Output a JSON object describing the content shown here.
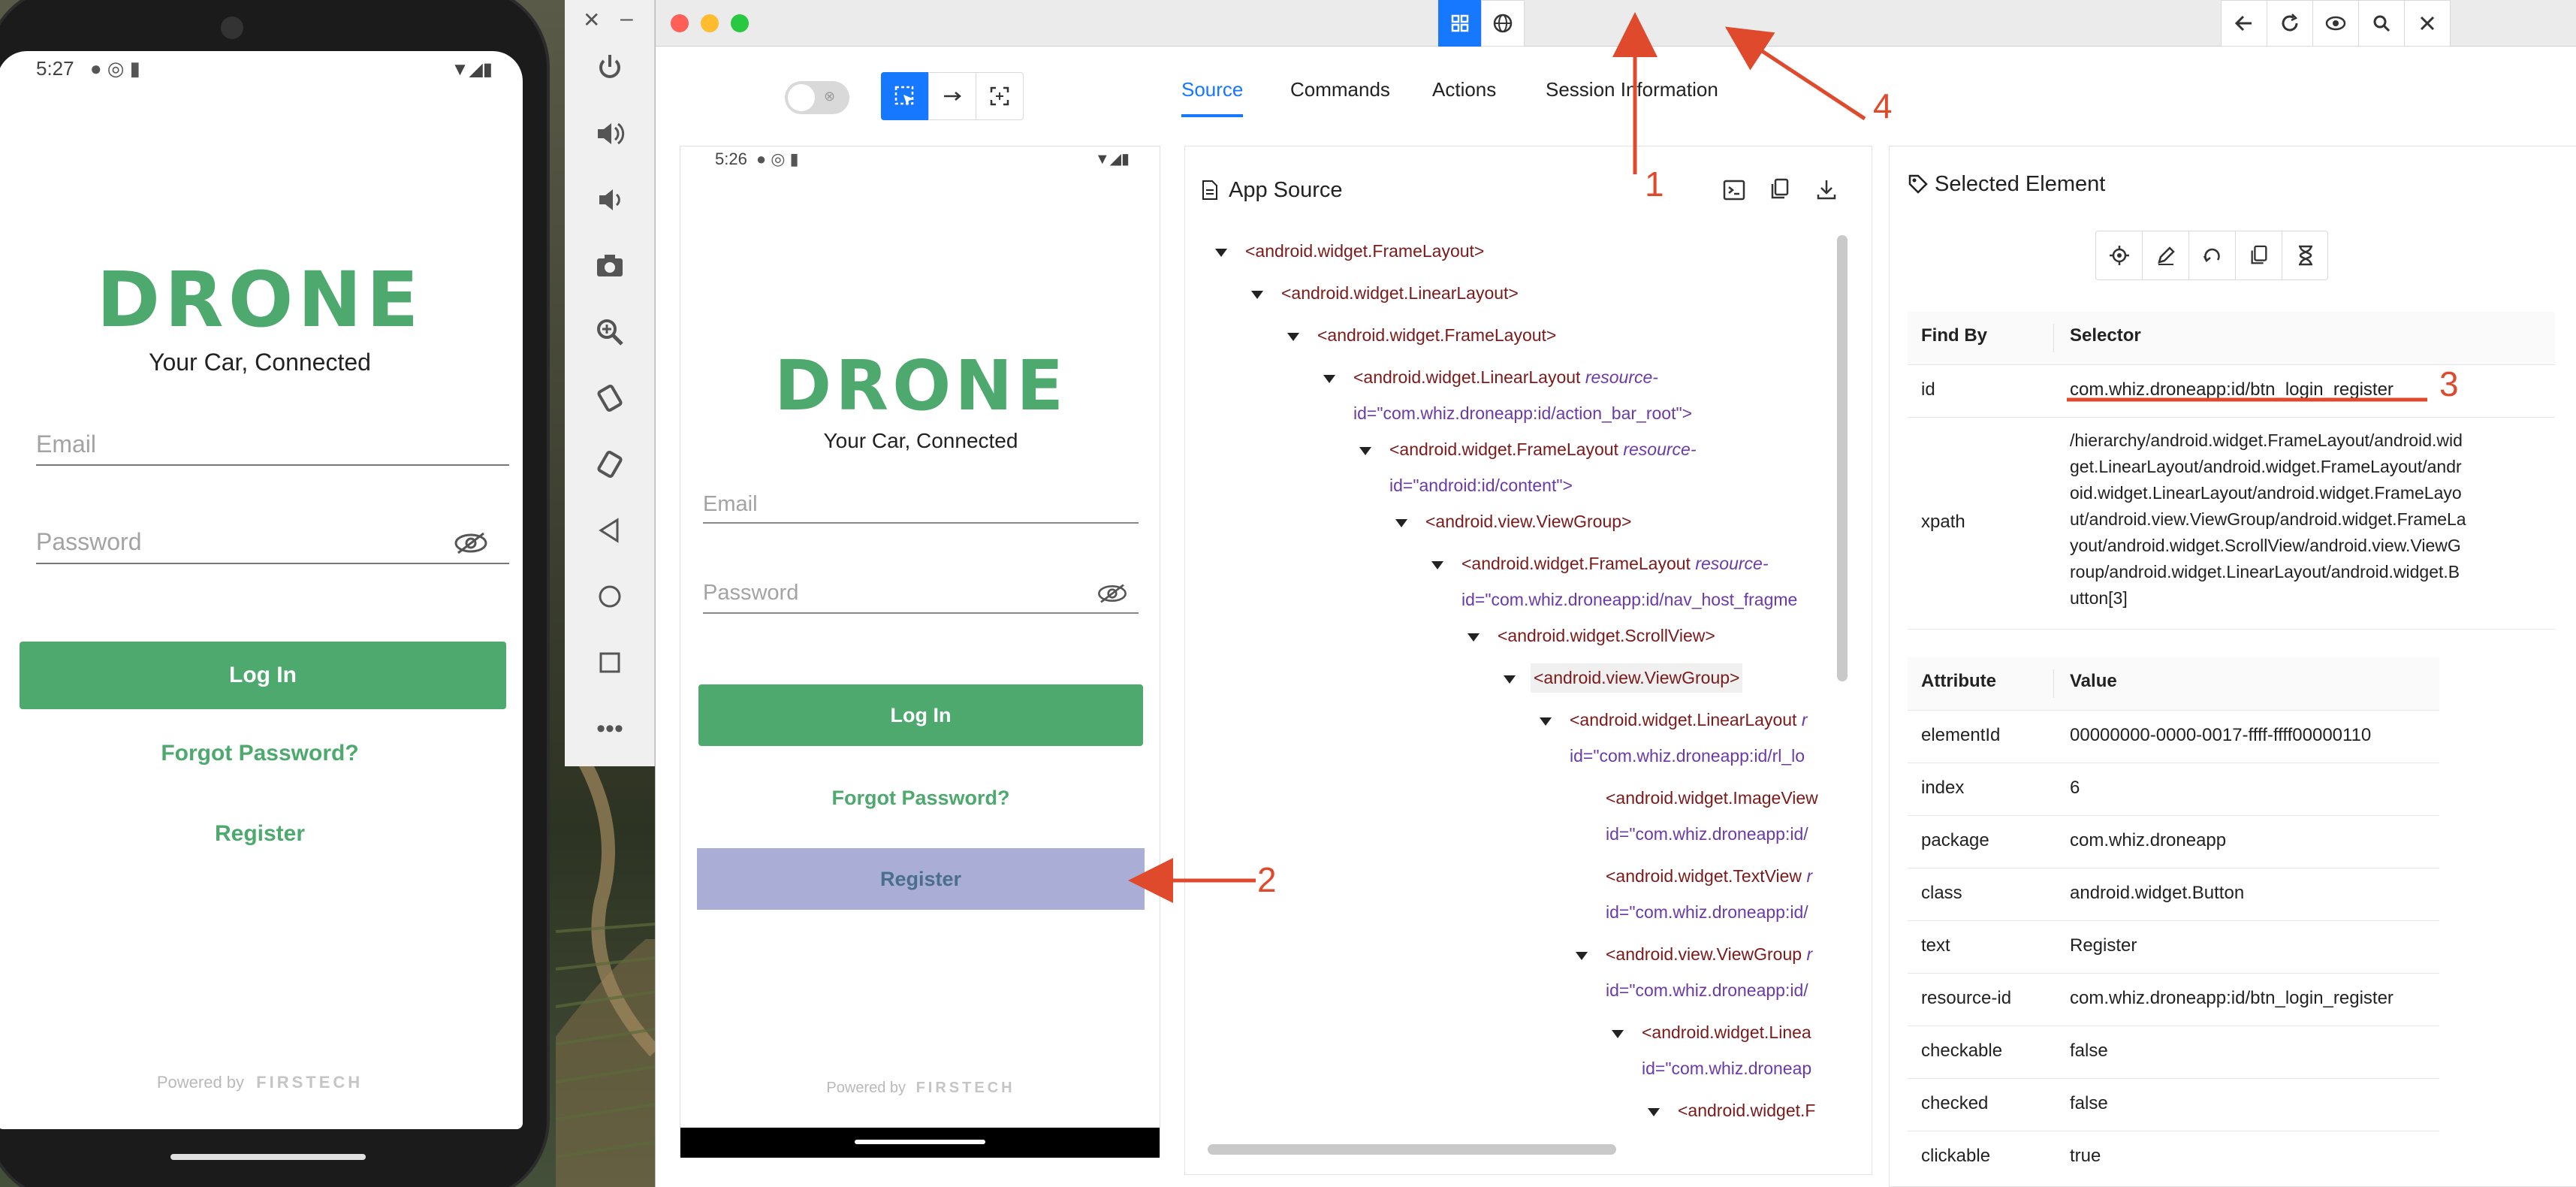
{
  "phone": {
    "time": "5:27",
    "logo": "DRONE",
    "tagline": "Your Car, Connected",
    "email_placeholder": "Email",
    "password_placeholder": "Password",
    "login": "Log In",
    "forgot": "Forgot Password?",
    "register": "Register",
    "powered_by": "Powered by",
    "brand": "FIRSTECH"
  },
  "window": {
    "toolbar_buttons": [
      "grid-icon",
      "globe-icon",
      "back-arrow-icon",
      "refresh-icon",
      "eye-icon",
      "search-icon",
      "close-icon"
    ],
    "tabs": [
      "Source",
      "Commands",
      "Actions",
      "Session Information"
    ],
    "active_tab": "Source"
  },
  "preview": {
    "time": "5:26",
    "logo": "DRONE",
    "tagline": "Your Car, Connected",
    "email_placeholder": "Email",
    "password_placeholder": "Password",
    "login": "Log In",
    "forgot": "Forgot Password?",
    "register": "Register",
    "powered_by": "Powered by",
    "brand": "FIRSTECH"
  },
  "source": {
    "title": "App Source",
    "rows": [
      {
        "tag": "<android.widget.FrameLayout>"
      },
      {
        "tag": "<android.widget.LinearLayout>"
      },
      {
        "tag": "<android.widget.FrameLayout>"
      },
      {
        "tag": "<android.widget.LinearLayout",
        "attr": "resource-",
        "cont": "id=\"com.whiz.droneapp:id/action_bar_root\">"
      },
      {
        "tag": "<android.widget.FrameLayout",
        "attr": "resource-",
        "cont": "id=\"android:id/content\">"
      },
      {
        "tag": "<android.view.ViewGroup>"
      },
      {
        "tag": "<android.widget.FrameLayout",
        "attr": "resource-",
        "cont": "id=\"com.whiz.droneapp:id/nav_host_fragme"
      },
      {
        "tag": "<android.widget.ScrollView>"
      },
      {
        "tag": "<android.view.ViewGroup>"
      },
      {
        "tag": "<android.widget.LinearLayout",
        "attr": "r",
        "cont": "id=\"com.whiz.droneapp:id/rl_lo"
      },
      {
        "tag": "<android.widget.ImageView",
        "attr": "",
        "cont": "id=\"com.whiz.droneapp:id/"
      },
      {
        "tag": "<android.widget.TextView",
        "attr": "r",
        "cont": "id=\"com.whiz.droneapp:id/"
      },
      {
        "tag": "<android.view.ViewGroup",
        "attr": "r",
        "cont": "id=\"com.whiz.droneapp:id/"
      },
      {
        "tag": "<android.widget.Linea",
        "attr": "",
        "cont": "id=\"com.whiz.droneap"
      },
      {
        "tag": "<android.widget.F",
        "attr": "",
        "cont": ""
      }
    ]
  },
  "selected": {
    "title": "Selected Element",
    "find_by_header": "Find By",
    "selector_header": "Selector",
    "id_label": "id",
    "id_value": "com.whiz.droneapp:id/btn_login_register",
    "xpath_label": "xpath",
    "xpath_lines": [
      "/hierarchy/android.widget.FrameLayout/android.wid",
      "get.LinearLayout/android.widget.FrameLayout/andr",
      "oid.widget.LinearLayout/android.widget.FrameLayo",
      "ut/android.view.ViewGroup/android.widget.FrameLa",
      "yout/android.widget.ScrollView/android.view.ViewG",
      "roup/android.widget.LinearLayout/android.widget.B",
      "utton[3]"
    ],
    "attribute_header": "Attribute",
    "value_header": "Value",
    "attributes": [
      {
        "name": "elementId",
        "value": "00000000-0000-0017-ffff-ffff00000110"
      },
      {
        "name": "index",
        "value": "6"
      },
      {
        "name": "package",
        "value": "com.whiz.droneapp"
      },
      {
        "name": "class",
        "value": "android.widget.Button"
      },
      {
        "name": "text",
        "value": "Register"
      },
      {
        "name": "resource-id",
        "value": "com.whiz.droneapp:id/btn_login_register"
      },
      {
        "name": "checkable",
        "value": "false"
      },
      {
        "name": "checked",
        "value": "false"
      },
      {
        "name": "clickable",
        "value": "true"
      }
    ]
  },
  "annotations": [
    "1",
    "2",
    "3",
    "4"
  ],
  "colors": {
    "accent": "#4ea96f",
    "appium_blue": "#1677ff",
    "highlight": "#aaaed6",
    "annotation": "#e04a2c"
  }
}
